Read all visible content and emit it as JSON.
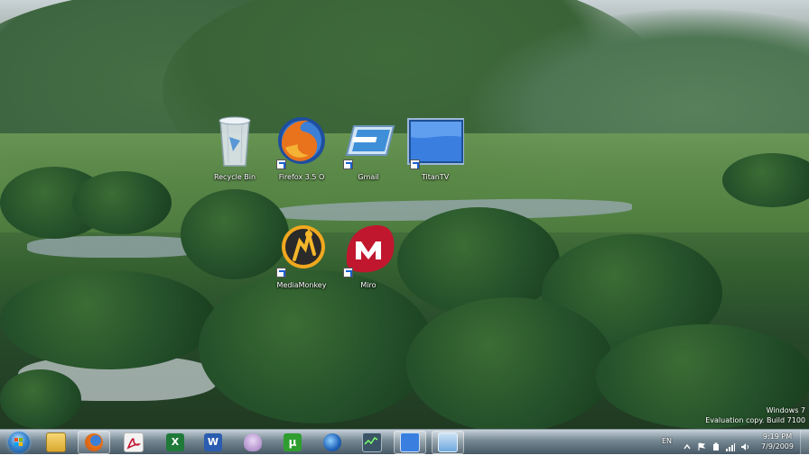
{
  "desktop_icons": [
    {
      "name": "recycle-bin",
      "label": "Recycle Bin",
      "shortcut": false
    },
    {
      "name": "firefox",
      "label": "Firefox 3.5 O",
      "shortcut": true
    },
    {
      "name": "gmail",
      "label": "Gmail",
      "shortcut": true
    },
    {
      "name": "titantv",
      "label": "TitanTV",
      "shortcut": true
    },
    {
      "name": "mediamonkey",
      "label": "MediaMonkey",
      "shortcut": true
    },
    {
      "name": "miro",
      "label": "Miro",
      "shortcut": true
    }
  ],
  "watermark": {
    "line1": "Windows 7",
    "line2": "Evaluation copy. Build 7100"
  },
  "taskbar": {
    "pinned": [
      {
        "name": "explorer",
        "icon": "folder-icon"
      },
      {
        "name": "firefox",
        "icon": "firefox-icon",
        "active": true
      },
      {
        "name": "acrobat",
        "icon": "acrobat-icon"
      },
      {
        "name": "excel",
        "icon": "excel-icon"
      },
      {
        "name": "word",
        "icon": "word-icon"
      },
      {
        "name": "pidgin",
        "icon": "pidgin-icon"
      },
      {
        "name": "utorrent",
        "icon": "utorrent-icon"
      },
      {
        "name": "google-earth",
        "icon": "google-earth-icon"
      },
      {
        "name": "cpu-monitor",
        "icon": "monitor-icon"
      },
      {
        "name": "titantv",
        "icon": "titantv-icon",
        "active": true
      },
      {
        "name": "window",
        "icon": "window-icon",
        "active": true
      }
    ],
    "tray": {
      "language": "EN",
      "time": "9:19 PM",
      "date": "7/9/2009"
    }
  },
  "colors": {
    "label_text": "#ffffff",
    "excel_green": "#1f7a3a",
    "word_blue": "#2a5db0",
    "firefox_orange": "#e8731c",
    "miro_red": "#c0172f"
  }
}
